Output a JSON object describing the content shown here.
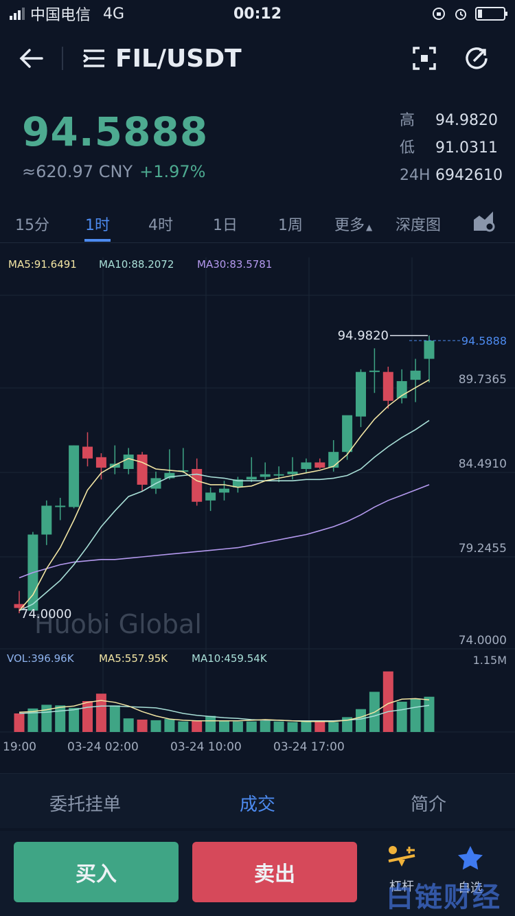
{
  "status": {
    "carrier": "中国电信",
    "network": "4G",
    "time": "00:12"
  },
  "nav": {
    "back": "←",
    "pair": "FIL/USDT"
  },
  "ticker": {
    "price": "94.5888",
    "cny": "≈620.97 CNY",
    "change": "+1.97%",
    "high_label": "高",
    "high": "94.9820",
    "low_label": "低",
    "low": "91.0311",
    "vol_label": "24H",
    "vol": "6942610"
  },
  "tabs": [
    {
      "label": "15分"
    },
    {
      "label": "1时"
    },
    {
      "label": "4时"
    },
    {
      "label": "1日"
    },
    {
      "label": "1周"
    },
    {
      "label": "更多"
    },
    {
      "label": "深度图"
    }
  ],
  "indicators": {
    "ma5": "MA5:91.6491",
    "ma10": "MA10:88.2072",
    "ma30": "MA30:83.5781"
  },
  "chart_data": {
    "type": "candlestick",
    "y_ticks": [
      "89.7365",
      "84.4910",
      "79.2455",
      "74.0000"
    ],
    "ylim": [
      71.5,
      97.0
    ],
    "last_price_label": "94.5888",
    "max_label": "94.9820",
    "min_label": "74.0000",
    "watermark": "Huobi Global",
    "x_ticks": [
      "19:00",
      "03-24 02:00",
      "03-24 10:00",
      "03-24 17:00"
    ],
    "colors": {
      "up": "#3fa585",
      "down": "#d6495a",
      "ma5": "#f3e6a4",
      "ma10": "#a9e0d8",
      "ma30": "#b59af0"
    },
    "candles": [
      {
        "o": 74.5,
        "h": 75.5,
        "l": 73.8,
        "c": 74.2
      },
      {
        "o": 74.0,
        "h": 80.0,
        "l": 74.0,
        "c": 79.8
      },
      {
        "o": 79.8,
        "h": 82.4,
        "l": 79.0,
        "c": 82.0
      },
      {
        "o": 82.0,
        "h": 82.6,
        "l": 80.9,
        "c": 82.0
      },
      {
        "o": 81.9,
        "h": 86.6,
        "l": 81.8,
        "c": 86.6
      },
      {
        "o": 86.5,
        "h": 87.6,
        "l": 85.0,
        "c": 85.6
      },
      {
        "o": 85.7,
        "h": 86.0,
        "l": 84.0,
        "c": 84.9
      },
      {
        "o": 84.9,
        "h": 86.6,
        "l": 84.4,
        "c": 85.2
      },
      {
        "o": 84.8,
        "h": 86.4,
        "l": 84.4,
        "c": 85.9
      },
      {
        "o": 85.9,
        "h": 86.1,
        "l": 83.1,
        "c": 83.6
      },
      {
        "o": 83.3,
        "h": 84.6,
        "l": 82.9,
        "c": 84.1
      },
      {
        "o": 84.1,
        "h": 86.3,
        "l": 84.0,
        "c": 84.5
      },
      {
        "o": 84.7,
        "h": 86.4,
        "l": 84.5,
        "c": 84.7
      },
      {
        "o": 84.8,
        "h": 85.6,
        "l": 82.0,
        "c": 82.3
      },
      {
        "o": 82.4,
        "h": 83.4,
        "l": 81.6,
        "c": 83.0
      },
      {
        "o": 83.0,
        "h": 83.9,
        "l": 82.4,
        "c": 83.3
      },
      {
        "o": 83.4,
        "h": 84.2,
        "l": 83.0,
        "c": 84.0
      },
      {
        "o": 84.0,
        "h": 85.7,
        "l": 83.8,
        "c": 84.2
      },
      {
        "o": 84.2,
        "h": 85.3,
        "l": 84.0,
        "c": 84.4
      },
      {
        "o": 84.3,
        "h": 85.0,
        "l": 83.8,
        "c": 84.4
      },
      {
        "o": 84.4,
        "h": 85.7,
        "l": 84.0,
        "c": 84.6
      },
      {
        "o": 84.8,
        "h": 85.6,
        "l": 84.5,
        "c": 85.3
      },
      {
        "o": 85.3,
        "h": 85.6,
        "l": 84.8,
        "c": 84.9
      },
      {
        "o": 84.9,
        "h": 87.0,
        "l": 84.6,
        "c": 86.1
      },
      {
        "o": 86.1,
        "h": 88.8,
        "l": 85.5,
        "c": 88.9
      },
      {
        "o": 88.8,
        "h": 92.4,
        "l": 88.0,
        "c": 92.2
      },
      {
        "o": 92.3,
        "h": 94.0,
        "l": 90.6,
        "c": 92.3
      },
      {
        "o": 92.2,
        "h": 92.6,
        "l": 89.4,
        "c": 90.0
      },
      {
        "o": 90.2,
        "h": 92.4,
        "l": 89.8,
        "c": 91.5
      },
      {
        "o": 91.6,
        "h": 93.2,
        "l": 89.9,
        "c": 92.3
      },
      {
        "o": 93.2,
        "h": 94.98,
        "l": 91.4,
        "c": 94.59
      }
    ],
    "ma5": [
      74.0,
      75.2,
      77.2,
      78.8,
      80.9,
      83.2,
      84.5,
      85.1,
      85.6,
      85.3,
      84.8,
      84.7,
      84.6,
      83.9,
      83.6,
      83.6,
      83.4,
      83.5,
      83.9,
      84.1,
      84.3,
      84.5,
      84.7,
      85.0,
      85.9,
      87.3,
      88.6,
      89.6,
      90.4,
      91.0,
      91.6
    ],
    "ma10": [
      74.0,
      74.5,
      75.4,
      76.3,
      77.5,
      78.9,
      80.4,
      81.6,
      82.7,
      83.1,
      83.7,
      84.2,
      84.3,
      84.4,
      84.2,
      84.1,
      83.9,
      83.9,
      83.9,
      83.9,
      83.9,
      84.0,
      84.0,
      84.1,
      84.3,
      84.8,
      85.7,
      86.5,
      87.2,
      87.8,
      88.5
    ],
    "ma30": [
      76.5,
      76.9,
      77.2,
      77.5,
      77.7,
      77.8,
      77.9,
      77.9,
      78.0,
      78.1,
      78.2,
      78.3,
      78.4,
      78.5,
      78.6,
      78.7,
      78.8,
      79.0,
      79.2,
      79.4,
      79.6,
      79.8,
      80.1,
      80.4,
      80.8,
      81.3,
      81.9,
      82.4,
      82.8,
      83.2,
      83.6
    ],
    "volume": {
      "label": "VOL:396.96K",
      "ma5_label": "MA5:557.95K",
      "ma10_label": "MA10:459.54K",
      "max_label": "1.15M",
      "values": [
        300,
        380,
        440,
        430,
        390,
        500,
        620,
        430,
        220,
        200,
        190,
        210,
        170,
        180,
        260,
        180,
        170,
        170,
        180,
        170,
        160,
        180,
        170,
        160,
        240,
        370,
        650,
        980,
        490,
        540,
        570
      ],
      "ma5": [
        320,
        330,
        360,
        400,
        420,
        480,
        510,
        480,
        420,
        330,
        260,
        210,
        190,
        180,
        180,
        180,
        180,
        190,
        200,
        190,
        180,
        170,
        170,
        170,
        190,
        240,
        320,
        460,
        530,
        540,
        520
      ],
      "ma10": [
        300,
        310,
        320,
        340,
        360,
        400,
        420,
        420,
        410,
        400,
        390,
        350,
        300,
        270,
        250,
        230,
        220,
        200,
        190,
        190,
        180,
        180,
        180,
        180,
        190,
        210,
        260,
        330,
        360,
        400,
        430
      ]
    }
  },
  "bottom_tabs": [
    {
      "label": "委托挂单"
    },
    {
      "label": "成交"
    },
    {
      "label": "简介"
    }
  ],
  "actions": {
    "buy": "买入",
    "sell": "卖出",
    "leverage": "杠杆",
    "favorite": "自选"
  },
  "watermark": "白链财经"
}
